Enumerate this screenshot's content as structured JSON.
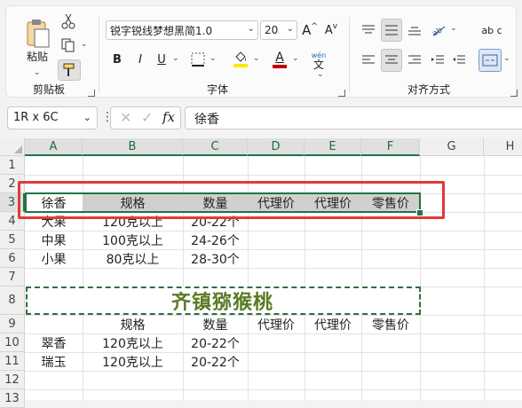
{
  "ribbon": {
    "clipboard": {
      "label": "剪贴板",
      "paste_label": "粘贴"
    },
    "font": {
      "label": "字体",
      "font_name": "锐字锐线梦想黑简1.0",
      "font_size": "20",
      "bold": "B",
      "italic": "I",
      "underline": "U",
      "grow": "A",
      "shrink": "A",
      "font_color_letter": "A",
      "pinyin_top": "wén",
      "pinyin_bottom": "文",
      "colors": {
        "highlight": "#ffe600",
        "font_color": "#c00000"
      }
    },
    "align": {
      "label": "对齐方式",
      "wrap_label": "ab c"
    }
  },
  "formula_bar": {
    "name_box": "1R x 6C",
    "fx": "fx",
    "content": "徐香"
  },
  "sheet": {
    "columns": [
      "A",
      "B",
      "C",
      "D",
      "E",
      "F",
      "G",
      "H"
    ],
    "rows": [
      "1",
      "2",
      "3",
      "4",
      "5",
      "6",
      "7",
      "8",
      "9",
      "10",
      "11",
      "12",
      "13"
    ],
    "cells": {
      "r3": [
        "徐香",
        "规格",
        "数量",
        "代理价",
        "代理价",
        "零售价"
      ],
      "r4": [
        "大果",
        "120克以上",
        "20-22个"
      ],
      "r5": [
        "中果",
        "100克以上",
        "24-26个"
      ],
      "r6": [
        "小果",
        "80克以上",
        "28-30个"
      ],
      "r8_title": "齐镇猕猴桃",
      "r9": [
        "规格",
        "数量",
        "代理价",
        "代理价",
        "零售价"
      ],
      "r10": [
        "翠香",
        "120克以上",
        "20-22个"
      ],
      "r11": [
        "瑞玉",
        "120克以上",
        "20-22个"
      ]
    }
  }
}
